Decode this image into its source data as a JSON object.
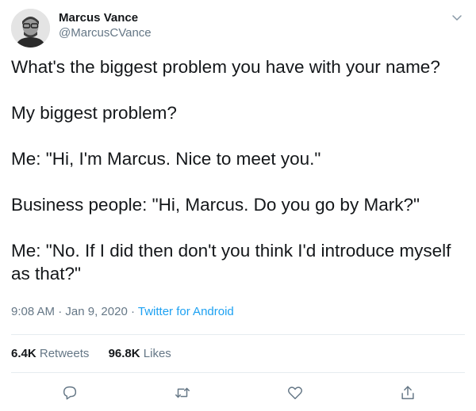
{
  "author": {
    "display_name": "Marcus Vance",
    "handle": "@MarcusCVance",
    "avatar_icon": "avatar"
  },
  "tweet": {
    "paragraphs": [
      "What's the biggest problem you have with your name?",
      "My biggest problem?",
      "Me: \"Hi, I'm Marcus. Nice to meet you.\"",
      "Business people: \"Hi, Marcus. Do you go by Mark?\"",
      "Me: \"No. If I did then don't you think I'd introduce myself as that?\""
    ]
  },
  "meta": {
    "time": "9:08 AM",
    "separator": "·",
    "date": "Jan 9, 2020",
    "source": "Twitter for Android"
  },
  "stats": {
    "retweets_count": "6.4K",
    "retweets_label": "Retweets",
    "likes_count": "96.8K",
    "likes_label": "Likes"
  },
  "actions": {
    "icons": [
      "reply-icon",
      "retweet-icon",
      "like-icon",
      "share-icon"
    ]
  },
  "colors": {
    "text": "#14171a",
    "secondary": "#657786",
    "link": "#1da1f2",
    "divider": "#e6ecf0"
  }
}
